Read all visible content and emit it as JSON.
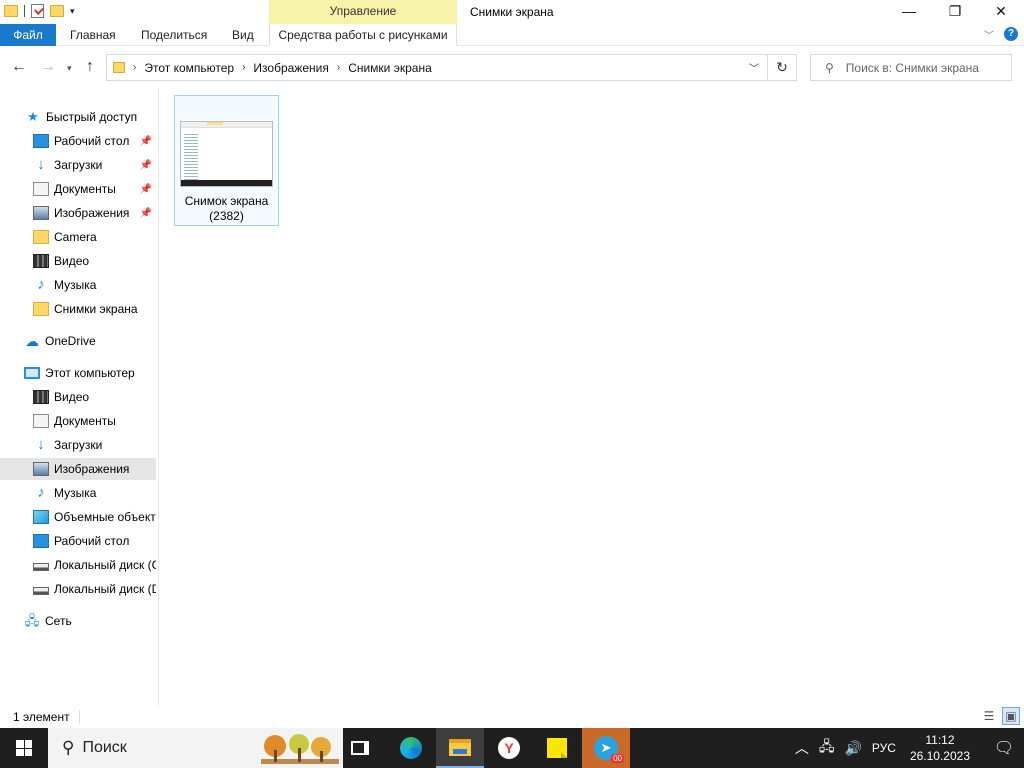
{
  "titlebar": {
    "context_tab": "Управление",
    "title": "Снимки экрана",
    "minimize": "—",
    "maximize": "❐",
    "close": "✕"
  },
  "ribbon": {
    "tabs": [
      "Файл",
      "Главная",
      "Поделиться",
      "Вид",
      "Средства работы с рисунками"
    ],
    "help": "?"
  },
  "address": {
    "crumbs": [
      "Этот компьютер",
      "Изображения",
      "Снимки экрана"
    ],
    "search_placeholder": "Поиск в: Снимки экрана"
  },
  "nav": {
    "quick_access": "Быстрый доступ",
    "quick_items": [
      {
        "label": "Рабочий стол",
        "icon": "desktop-icon",
        "pinned": true
      },
      {
        "label": "Загрузки",
        "icon": "download-icon",
        "pinned": true
      },
      {
        "label": "Документы",
        "icon": "documents-icon",
        "pinned": true
      },
      {
        "label": "Изображения",
        "icon": "pictures-icon",
        "pinned": true
      },
      {
        "label": "Camera",
        "icon": "folder-icon",
        "pinned": false
      },
      {
        "label": "Видео",
        "icon": "video-icon",
        "pinned": false
      },
      {
        "label": "Музыка",
        "icon": "music-icon",
        "pinned": false
      },
      {
        "label": "Снимки экрана",
        "icon": "folder-icon",
        "pinned": false
      }
    ],
    "onedrive": "OneDrive",
    "this_pc": "Этот компьютер",
    "pc_items": [
      {
        "label": "Видео",
        "icon": "video-icon"
      },
      {
        "label": "Документы",
        "icon": "documents-icon"
      },
      {
        "label": "Загрузки",
        "icon": "download-icon"
      },
      {
        "label": "Изображения",
        "icon": "pictures-icon",
        "selected": true
      },
      {
        "label": "Музыка",
        "icon": "music-icon"
      },
      {
        "label": "Объемные объекты",
        "icon": "3d-objects-icon"
      },
      {
        "label": "Рабочий стол",
        "icon": "desktop-icon"
      },
      {
        "label": "Локальный диск (C:)",
        "icon": "drive-icon"
      },
      {
        "label": "Локальный диск (D:)",
        "icon": "drive-icon"
      }
    ],
    "network": "Сеть"
  },
  "content": {
    "files": [
      {
        "name_line1": "Снимок экрана",
        "name_line2": "(2382)"
      }
    ]
  },
  "status": {
    "count": "1 элемент"
  },
  "taskbar": {
    "search_text": "Поиск",
    "tray_lang": "РУС",
    "time": "11:12",
    "date": "26.10.2023",
    "telegram_badge": "00"
  },
  "colors": {
    "file_tab": "#1979ca",
    "context_tab": "#f7f3a8",
    "selection": "#e5e5e5",
    "taskbar": "#1f1f1f"
  }
}
